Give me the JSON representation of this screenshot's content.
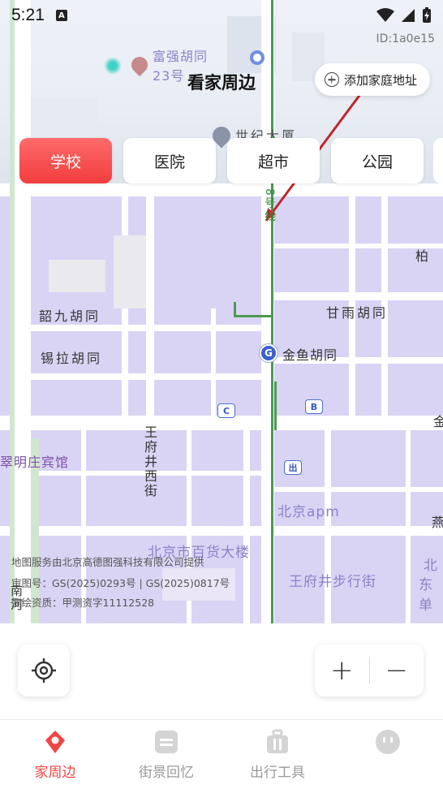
{
  "status_bar": {
    "time": "5:21",
    "notification_icon": "A"
  },
  "header": {
    "title": "看家周边",
    "device_id": "ID:1a0e15",
    "add_address_label": "添加家庭地址"
  },
  "category_tabs": [
    {
      "label": "学校",
      "active": true
    },
    {
      "label": "医院",
      "active": false
    },
    {
      "label": "超市",
      "active": false
    },
    {
      "label": "公园",
      "active": false
    }
  ],
  "map": {
    "labels": {
      "fuqiang_hutong": "富强胡同",
      "num_23": "23号",
      "shiji_dasha": "世纪大厦",
      "line8": "8号线",
      "shaojiu_hutong": "韶九胡同",
      "xila_hutong": "锡拉胡同",
      "ganyu_hutong": "甘雨胡同",
      "jinyu_hutong": "金鱼胡同",
      "wangfujing_xijie": "王府井西街",
      "cuimingzhuang_hotel": "翠明庄宾馆",
      "beijing_apm": "北京apm",
      "baihuo_dalou": "北京市百货大楼",
      "buxingjie": "王府井步行街",
      "bai": "柏",
      "bei": "北",
      "dongdan": "东单",
      "yan": "燕",
      "jin": "金",
      "nanhe": "南河",
      "exit": "出"
    },
    "credits": [
      "地图服务由北京高德图强科技有限公司提供",
      "审图号：GS(2025)0293号 | GS(2025)0817号",
      "测绘资质：甲测资字11112528"
    ]
  },
  "controls": {
    "zoom_in": "+",
    "zoom_out": "−"
  },
  "bottom_nav": [
    {
      "label": "家周边",
      "icon": "location-pin-icon",
      "active": true
    },
    {
      "label": "街景回忆",
      "icon": "card-icon",
      "active": false
    },
    {
      "label": "出行工具",
      "icon": "suitcase-icon",
      "active": false
    },
    {
      "label": "",
      "icon": "avatar-face-icon",
      "active": false
    }
  ],
  "colors": {
    "accent": "#f04545",
    "map_block": "#d9d4f4",
    "metro_line": "#4a9a52",
    "annotation_arrow": "#c0262d"
  }
}
